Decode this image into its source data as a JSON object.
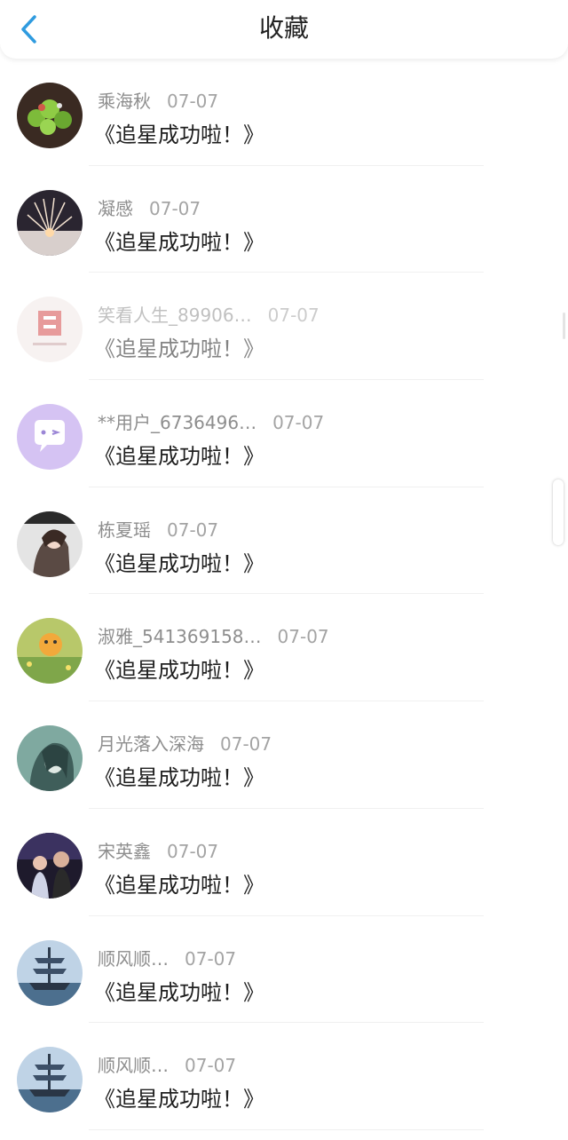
{
  "header": {
    "title": "收藏",
    "back_icon": "chevron-left-icon",
    "accent": "#2f9bdf"
  },
  "items": [
    {
      "name": "乘海秋",
      "date": "07-07",
      "message": "《追星成功啦！》"
    },
    {
      "name": "凝感",
      "date": "07-07",
      "message": "《追星成功啦！》"
    },
    {
      "name": "笑看人生_89906…",
      "date": "07-07",
      "message": "《追星成功啦！》"
    },
    {
      "name": "**用户_6736496…",
      "date": "07-07",
      "message": "《追星成功啦！》"
    },
    {
      "name": "栋夏瑶",
      "date": "07-07",
      "message": "《追星成功啦！》"
    },
    {
      "name": "淑雅_541369158…",
      "date": "07-07",
      "message": "《追星成功啦！》"
    },
    {
      "name": "月光落入深海",
      "date": "07-07",
      "message": "《追星成功啦！》"
    },
    {
      "name": "宋英鑫",
      "date": "07-07",
      "message": "《追星成功啦！》"
    },
    {
      "name": "顺风顺…",
      "date": "07-07",
      "message": "《追星成功啦！》"
    },
    {
      "name": "顺风顺…",
      "date": "07-07",
      "message": "《追星成功啦！》"
    }
  ]
}
